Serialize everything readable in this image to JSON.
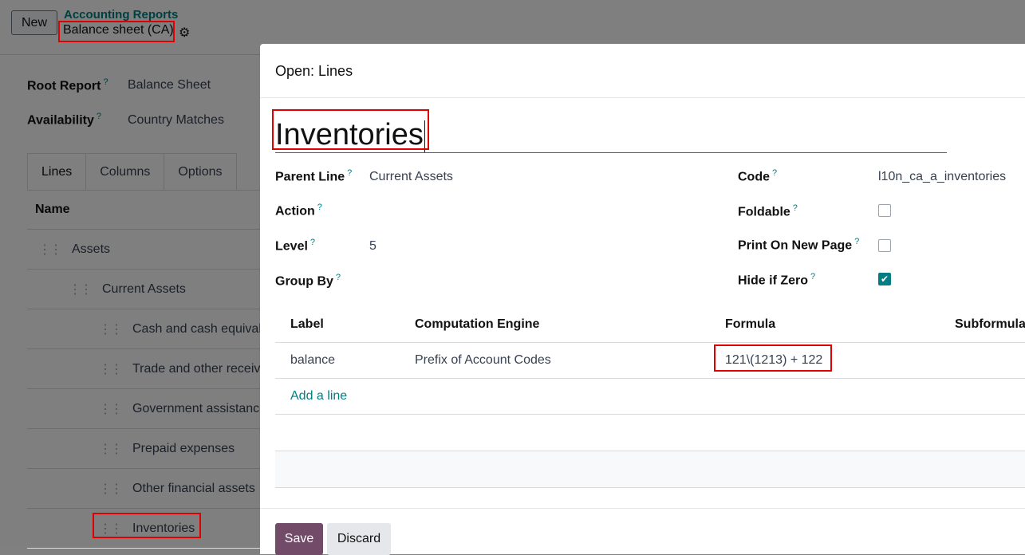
{
  "background": {
    "new_button": "New",
    "breadcrumb_parent": "Accounting Reports",
    "breadcrumb_current": "Balance sheet (CA)",
    "root_report_label": "Root Report",
    "root_report_value": "Balance Sheet",
    "availability_label": "Availability",
    "availability_value": "Country Matches",
    "tabs": [
      "Lines",
      "Columns",
      "Options"
    ],
    "table_header": "Name",
    "rows": [
      {
        "label": "Assets"
      },
      {
        "label": "Current Assets"
      },
      {
        "label": "Cash and cash equivalents"
      },
      {
        "label": "Trade and other receivables"
      },
      {
        "label": "Government assistance"
      },
      {
        "label": "Prepaid expenses"
      },
      {
        "label": "Other financial assets"
      },
      {
        "label": "Inventories"
      }
    ]
  },
  "dialog": {
    "title": "Open: Lines",
    "name": "Inventories",
    "fields": {
      "parent_line_label": "Parent Line",
      "parent_line_value": "Current Assets",
      "action_label": "Action",
      "level_label": "Level",
      "level_value": "5",
      "group_by_label": "Group By",
      "code_label": "Code",
      "code_value": "l10n_ca_a_inventories",
      "foldable_label": "Foldable",
      "foldable_checked": false,
      "print_new_page_label": "Print On New Page",
      "print_new_page_checked": false,
      "hide_if_zero_label": "Hide if Zero",
      "hide_if_zero_checked": true
    },
    "expressions": {
      "columns": [
        "Label",
        "Computation Engine",
        "Formula",
        "Subformula"
      ],
      "rows": [
        {
          "label": "balance",
          "engine": "Prefix of Account Codes",
          "formula": "121\\(1213) + 122"
        }
      ],
      "add_line": "Add a line"
    },
    "save_button": "Save",
    "discard_button": "Discard"
  },
  "tooltip_marker": "?"
}
